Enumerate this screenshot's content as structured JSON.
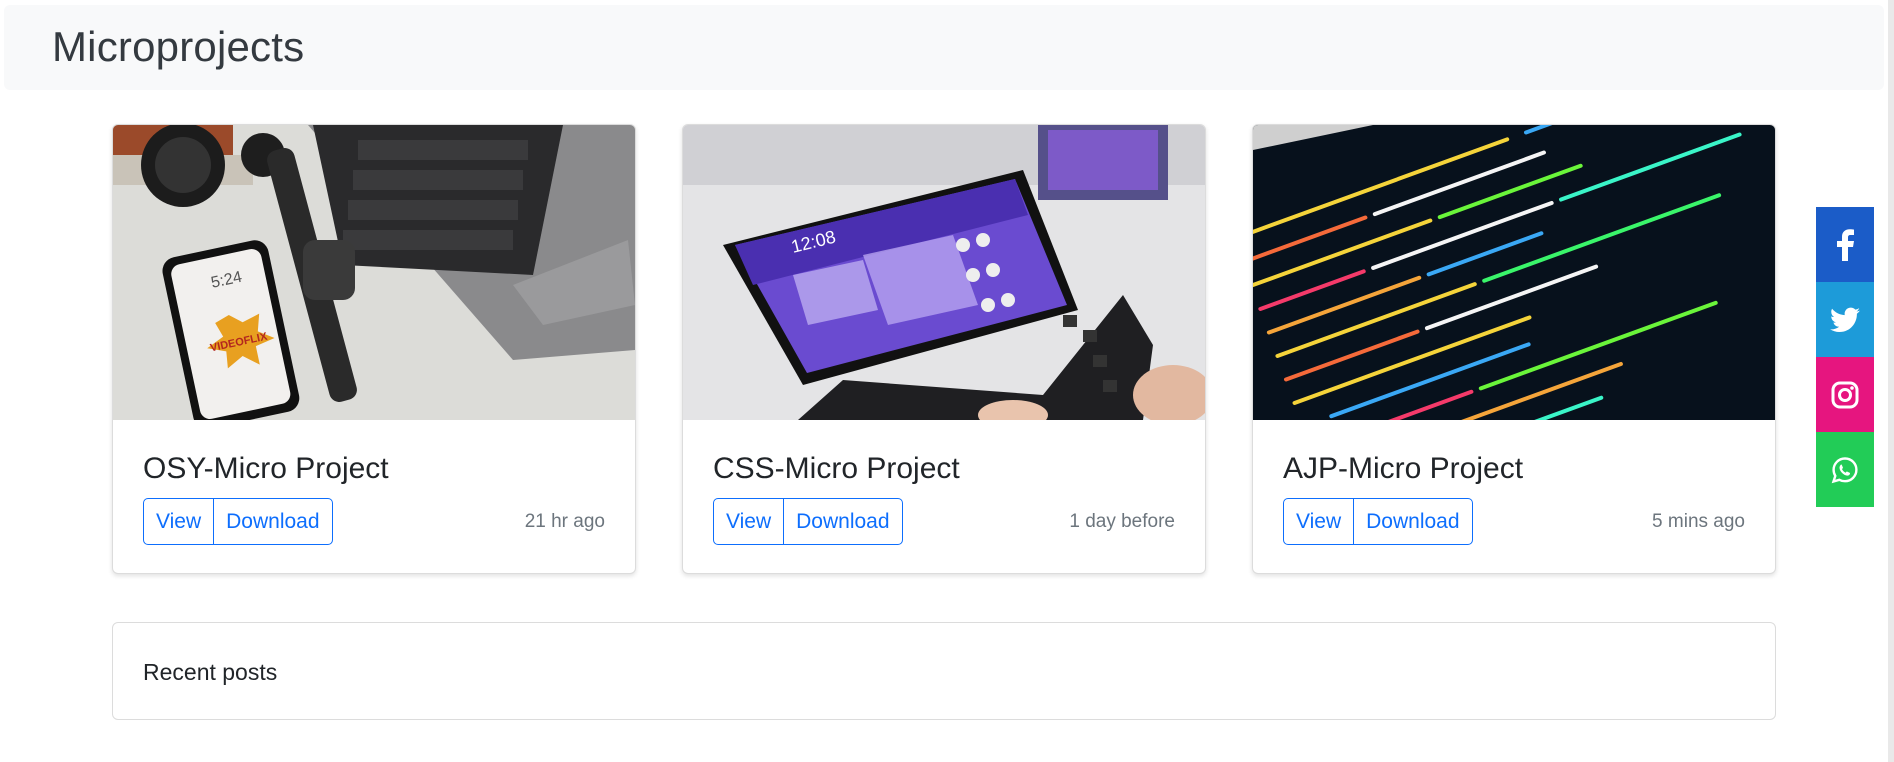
{
  "header": {
    "title": "Microprojects"
  },
  "cards": [
    {
      "title": "OSY-Micro Project",
      "view_label": "View",
      "download_label": "Download",
      "time": "21 hr ago",
      "phone_time": "5:24",
      "sticker_text": "VIDEOFLIX"
    },
    {
      "title": "CSS-Micro Project",
      "view_label": "View",
      "download_label": "Download",
      "time": "1 day before",
      "tablet_time": "12:08"
    },
    {
      "title": "AJP-Micro Project",
      "view_label": "View",
      "download_label": "Download",
      "time": "5 mins ago"
    }
  ],
  "recent_posts": {
    "label": "Recent posts"
  },
  "social": [
    {
      "name": "facebook",
      "icon": "facebook-icon",
      "color": "#1b5cc8"
    },
    {
      "name": "twitter",
      "icon": "twitter-icon",
      "color": "#1d9bd9"
    },
    {
      "name": "instagram",
      "icon": "instagram-icon",
      "color": "#e6157f"
    },
    {
      "name": "whatsapp",
      "icon": "whatsapp-icon",
      "color": "#22cc57"
    }
  ],
  "colors": {
    "primary": "#0d6efd",
    "muted": "#6c757d",
    "header_bg": "#f8f9fa"
  }
}
